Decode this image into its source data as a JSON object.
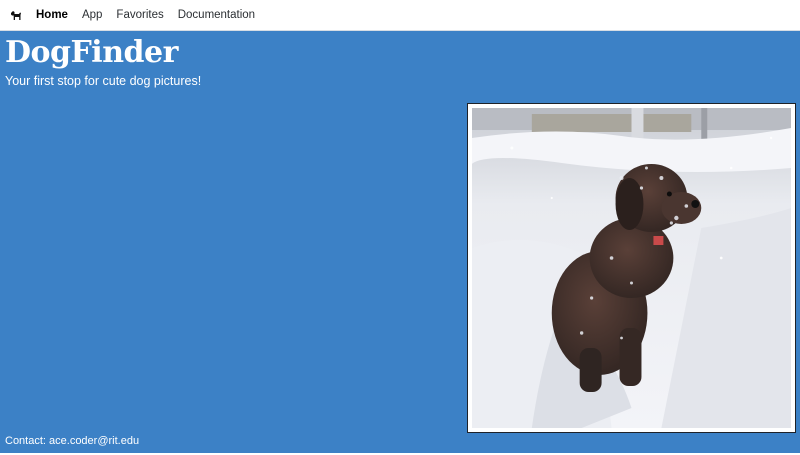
{
  "navbar": {
    "brand_icon": "dog-icon",
    "links": [
      {
        "label": "Home",
        "active": true
      },
      {
        "label": "App",
        "active": false
      },
      {
        "label": "Favorites",
        "active": false
      },
      {
        "label": "Documentation",
        "active": false
      }
    ]
  },
  "hero": {
    "title": "DogFinder",
    "tagline": "Your first stop for cute dog pictures!",
    "image_subject": "brown curly dog standing in snow",
    "background_color": "#3c81c6"
  },
  "footer": {
    "contact": "Contact: ace.coder@rit.edu"
  }
}
